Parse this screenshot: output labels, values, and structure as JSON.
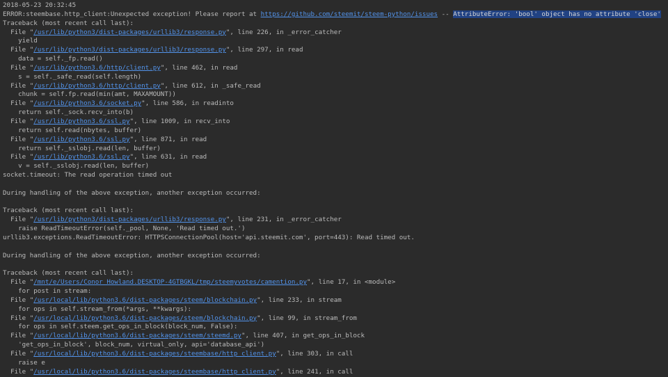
{
  "lines": [
    [
      {
        "t": "2018-05-23 20:32:45"
      }
    ],
    [
      {
        "t": "ERROR:steembase.http_client:Unexpected exception! Please report at "
      },
      {
        "t": "https://github.com/steemit/steem-python/issues",
        "k": "link"
      },
      {
        "t": " -- "
      },
      {
        "t": "AttributeError: 'bool' object has no attribute 'close'",
        "k": "sel"
      }
    ],
    [
      {
        "t": "Traceback (most recent call last):"
      }
    ],
    [
      {
        "t": "  File \""
      },
      {
        "t": "/usr/lib/python3/dist-packages/urllib3/response.py",
        "k": "link"
      },
      {
        "t": "\", line 226, in _error_catcher"
      }
    ],
    [
      {
        "t": "    yield"
      }
    ],
    [
      {
        "t": "  File \""
      },
      {
        "t": "/usr/lib/python3/dist-packages/urllib3/response.py",
        "k": "link"
      },
      {
        "t": "\", line 297, in read"
      }
    ],
    [
      {
        "t": "    data = self._fp.read()"
      }
    ],
    [
      {
        "t": "  File \""
      },
      {
        "t": "/usr/lib/python3.6/http/client.py",
        "k": "link"
      },
      {
        "t": "\", line 462, in read"
      }
    ],
    [
      {
        "t": "    s = self._safe_read(self.length)"
      }
    ],
    [
      {
        "t": "  File \""
      },
      {
        "t": "/usr/lib/python3.6/http/client.py",
        "k": "link"
      },
      {
        "t": "\", line 612, in _safe_read"
      }
    ],
    [
      {
        "t": "    chunk = self.fp.read(min(amt, MAXAMOUNT))"
      }
    ],
    [
      {
        "t": "  File \""
      },
      {
        "t": "/usr/lib/python3.6/socket.py",
        "k": "link"
      },
      {
        "t": "\", line 586, in readinto"
      }
    ],
    [
      {
        "t": "    return self._sock.recv_into(b)"
      }
    ],
    [
      {
        "t": "  File \""
      },
      {
        "t": "/usr/lib/python3.6/ssl.py",
        "k": "link"
      },
      {
        "t": "\", line 1009, in recv_into"
      }
    ],
    [
      {
        "t": "    return self.read(nbytes, buffer)"
      }
    ],
    [
      {
        "t": "  File \""
      },
      {
        "t": "/usr/lib/python3.6/ssl.py",
        "k": "link"
      },
      {
        "t": "\", line 871, in read"
      }
    ],
    [
      {
        "t": "    return self._sslobj.read(len, buffer)"
      }
    ],
    [
      {
        "t": "  File \""
      },
      {
        "t": "/usr/lib/python3.6/ssl.py",
        "k": "link"
      },
      {
        "t": "\", line 631, in read"
      }
    ],
    [
      {
        "t": "    v = self._sslobj.read(len, buffer)"
      }
    ],
    [
      {
        "t": "socket.timeout: The read operation timed out"
      }
    ],
    [
      {
        "t": ""
      }
    ],
    [
      {
        "t": "During handling of the above exception, another exception occurred:"
      }
    ],
    [
      {
        "t": ""
      }
    ],
    [
      {
        "t": "Traceback (most recent call last):"
      }
    ],
    [
      {
        "t": "  File \""
      },
      {
        "t": "/usr/lib/python3/dist-packages/urllib3/response.py",
        "k": "link"
      },
      {
        "t": "\", line 231, in _error_catcher"
      }
    ],
    [
      {
        "t": "    raise ReadTimeoutError(self._pool, None, 'Read timed out.')"
      }
    ],
    [
      {
        "t": "urllib3.exceptions.ReadTimeoutError: HTTPSConnectionPool(host='api.steemit.com', port=443): Read timed out."
      }
    ],
    [
      {
        "t": ""
      }
    ],
    [
      {
        "t": "During handling of the above exception, another exception occurred:"
      }
    ],
    [
      {
        "t": ""
      }
    ],
    [
      {
        "t": "Traceback (most recent call last):"
      }
    ],
    [
      {
        "t": "  File \""
      },
      {
        "t": "/mnt/e/Users/Conor Howland.DESKTOP-4GTBGKL/tmp/steemyvotes/camention.py",
        "k": "link"
      },
      {
        "t": "\", line 17, in <module>"
      }
    ],
    [
      {
        "t": "    for post in stream:"
      }
    ],
    [
      {
        "t": "  File \""
      },
      {
        "t": "/usr/local/lib/python3.6/dist-packages/steem/blockchain.py",
        "k": "link"
      },
      {
        "t": "\", line 233, in stream"
      }
    ],
    [
      {
        "t": "    for ops in self.stream_from(*args, **kwargs):"
      }
    ],
    [
      {
        "t": "  File \""
      },
      {
        "t": "/usr/local/lib/python3.6/dist-packages/steem/blockchain.py",
        "k": "link"
      },
      {
        "t": "\", line 99, in stream_from"
      }
    ],
    [
      {
        "t": "    for ops in self.steem.get_ops_in_block(block_num, False):"
      }
    ],
    [
      {
        "t": "  File \""
      },
      {
        "t": "/usr/local/lib/python3.6/dist-packages/steem/steemd.py",
        "k": "link"
      },
      {
        "t": "\", line 407, in get_ops_in_block"
      }
    ],
    [
      {
        "t": "    'get_ops_in_block', block_num, virtual_only, api='database_api')"
      }
    ],
    [
      {
        "t": "  File \""
      },
      {
        "t": "/usr/local/lib/python3.6/dist-packages/steembase/http_client.py",
        "k": "link"
      },
      {
        "t": "\", line 303, in call"
      }
    ],
    [
      {
        "t": "    raise e"
      }
    ],
    [
      {
        "t": "  File \""
      },
      {
        "t": "/usr/local/lib/python3.6/dist-packages/steembase/http_client.py",
        "k": "link"
      },
      {
        "t": "\", line 241, in call"
      }
    ]
  ]
}
